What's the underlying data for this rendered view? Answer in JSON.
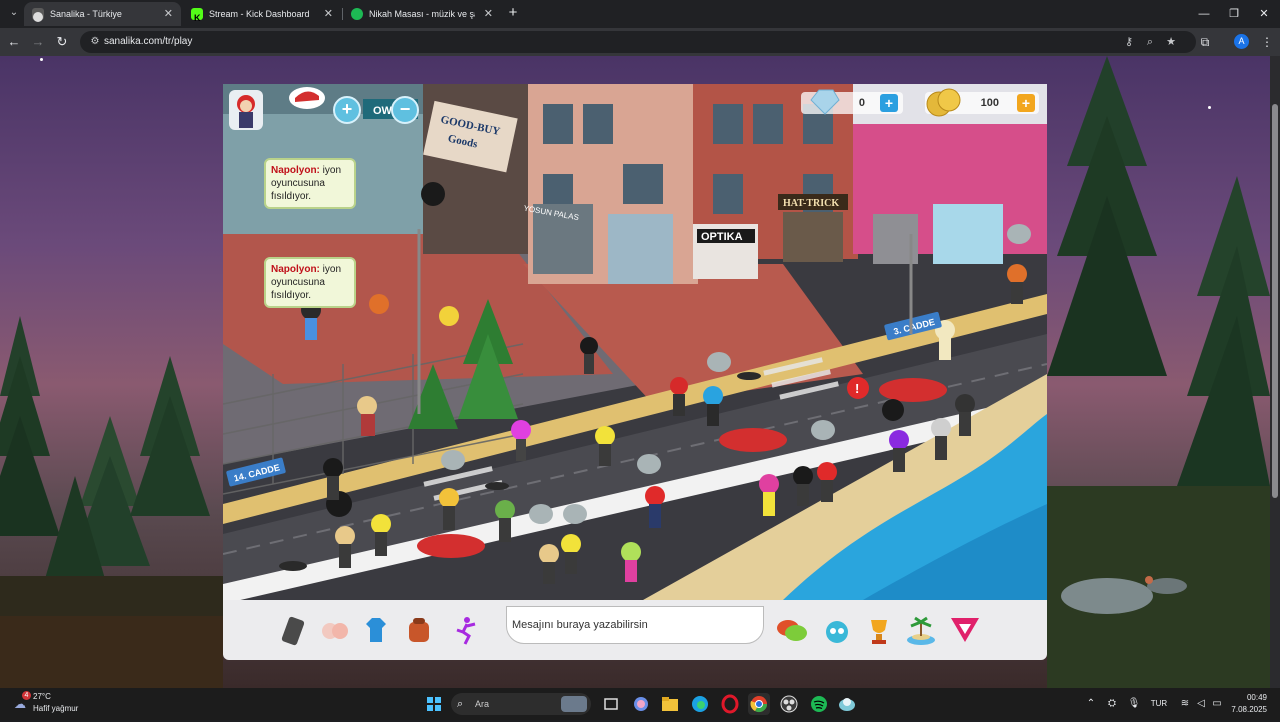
{
  "browser": {
    "tabs": [
      {
        "title": "Sanalika - Türkiye",
        "active": true,
        "icon": "sanalika-icon"
      },
      {
        "title": "Stream - Kick Dashboard",
        "active": false,
        "icon": "kick-icon"
      },
      {
        "title": "Nikah Masası - müzik ve şarkı s",
        "active": false,
        "icon": "spotify-icon"
      }
    ],
    "url": "sanalika.com/tr/play"
  },
  "game": {
    "diamonds": "0",
    "coins": "100",
    "bubbles": [
      {
        "nick": "Napolyon:",
        "text": " iyon oyuncusuna fısıldıyor."
      },
      {
        "nick": "Napolyon:",
        "text": " iyon oyuncusuna fısıldıyor."
      }
    ],
    "street_signs": [
      "3. CADDE",
      "14. CADDE"
    ],
    "shop_signs": [
      "GOOD-BUY Goods",
      "OPTIKA",
      "HAT-TRICK",
      "YOSUN PALAS",
      "OWL"
    ],
    "message_placeholder": "Mesajını buraya yazabilirsin",
    "toolbar_icons": [
      "phone-icon",
      "emote-icon",
      "wardrobe-icon",
      "backpack-icon",
      "dance-icon",
      "chat-icon",
      "alien-icon",
      "trophy-icon",
      "island-icon",
      "dropdown-triangle-icon"
    ]
  },
  "taskbar": {
    "weather_temp": "27°C",
    "weather_desc": "Hafif yağmur",
    "weather_badge": "4",
    "search_label": "Ara",
    "lang": "TUR",
    "time": "00:49",
    "date": "7.08.2025"
  },
  "colors": {
    "accent_blue": "#1a73e8",
    "plus_diamond": "#2b9fe0",
    "plus_coin": "#f2a61e",
    "bubble_bg": "#f1f7d9",
    "nick_red": "#c0101a"
  }
}
